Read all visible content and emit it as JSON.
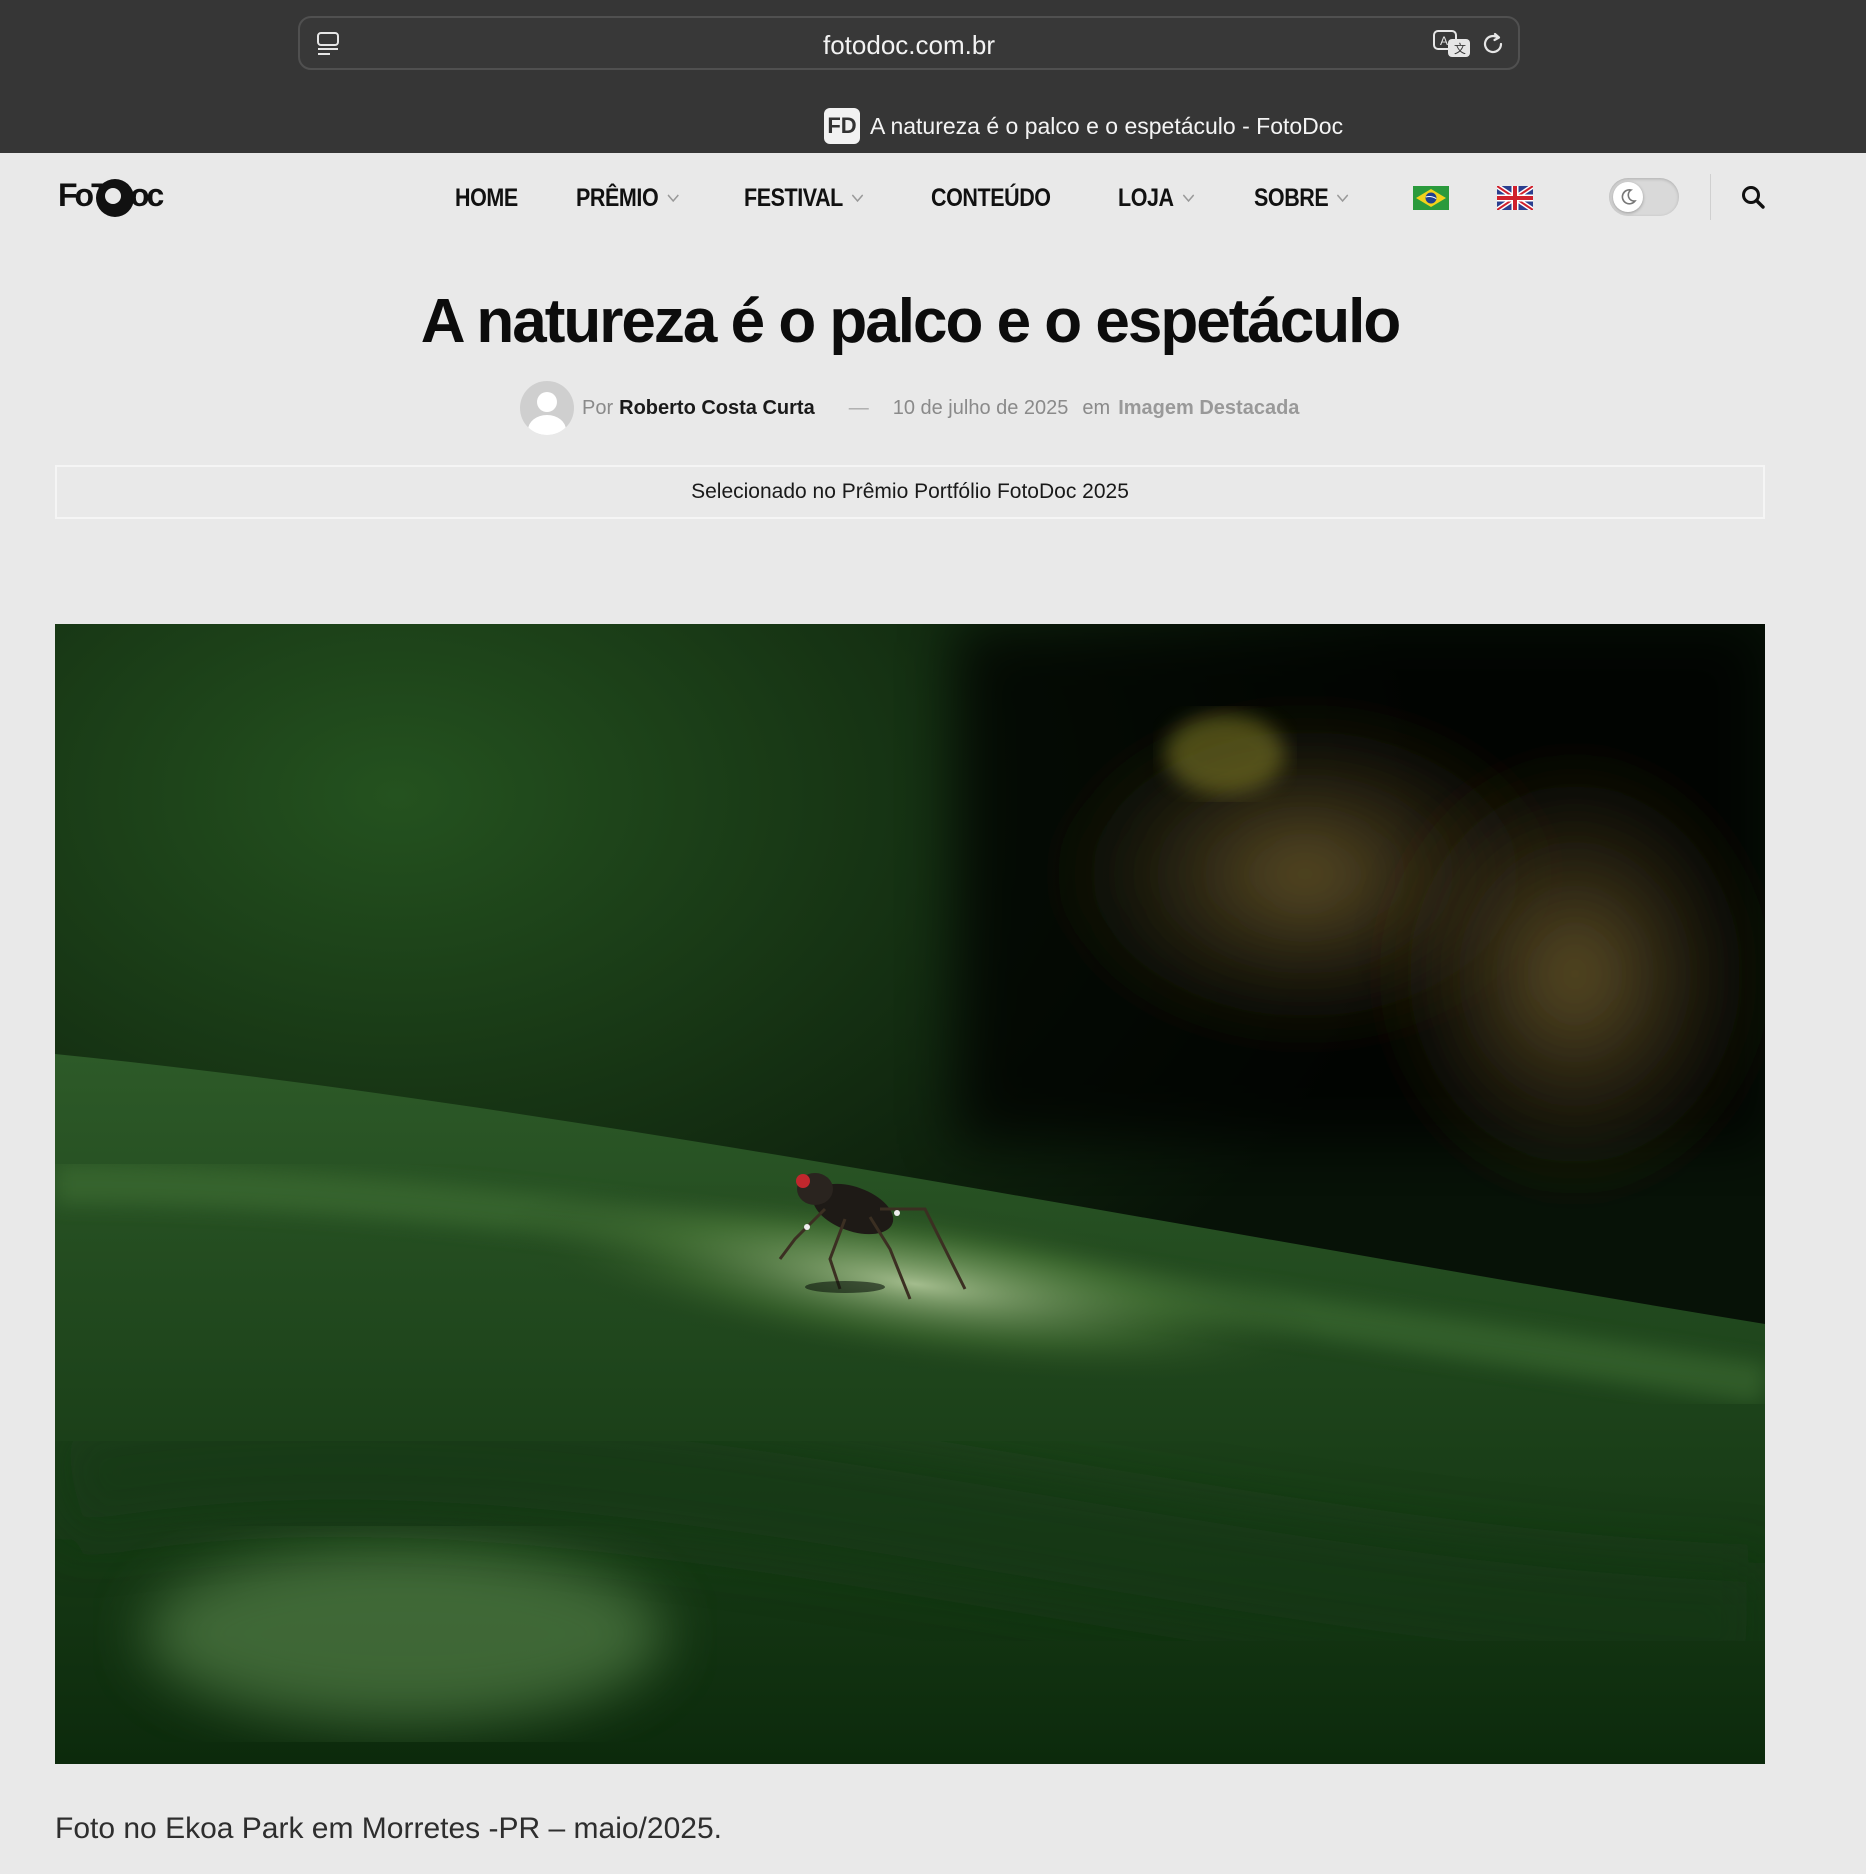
{
  "browser": {
    "url": "fotodoc.com.br",
    "tab_title": "A natureza é o palco e o espetáculo - FotoDoc",
    "favicon_text": "FD"
  },
  "header": {
    "logo_text": "FotoDoc",
    "nav": [
      {
        "label": "HOME",
        "dropdown": false
      },
      {
        "label": "PRÊMIO",
        "dropdown": true
      },
      {
        "label": "FESTIVAL",
        "dropdown": true
      },
      {
        "label": "CONTEÚDO",
        "dropdown": false
      },
      {
        "label": "LOJA",
        "dropdown": true
      },
      {
        "label": "SOBRE",
        "dropdown": true
      }
    ],
    "flags": [
      "brazil-flag-icon",
      "uk-flag-icon"
    ],
    "dark_mode_toggle": "off"
  },
  "article": {
    "title": "A natureza é o palco e o espetáculo",
    "by_label": "Por",
    "author": "Roberto Costa Curta",
    "dash": "—",
    "date": "10 de julho de 2025",
    "in_label": "em",
    "category": "Imagem Destacada",
    "notice": "Selecionado no Prêmio Portfólio FotoDoc 2025",
    "caption": "Foto no Ekoa Park em Morretes -PR – maio/2025."
  },
  "colors": {
    "chrome_bg": "#363636",
    "page_bg": "#e9e9e9",
    "text_dark": "#111111",
    "meta_gray": "#8a8a8a"
  }
}
